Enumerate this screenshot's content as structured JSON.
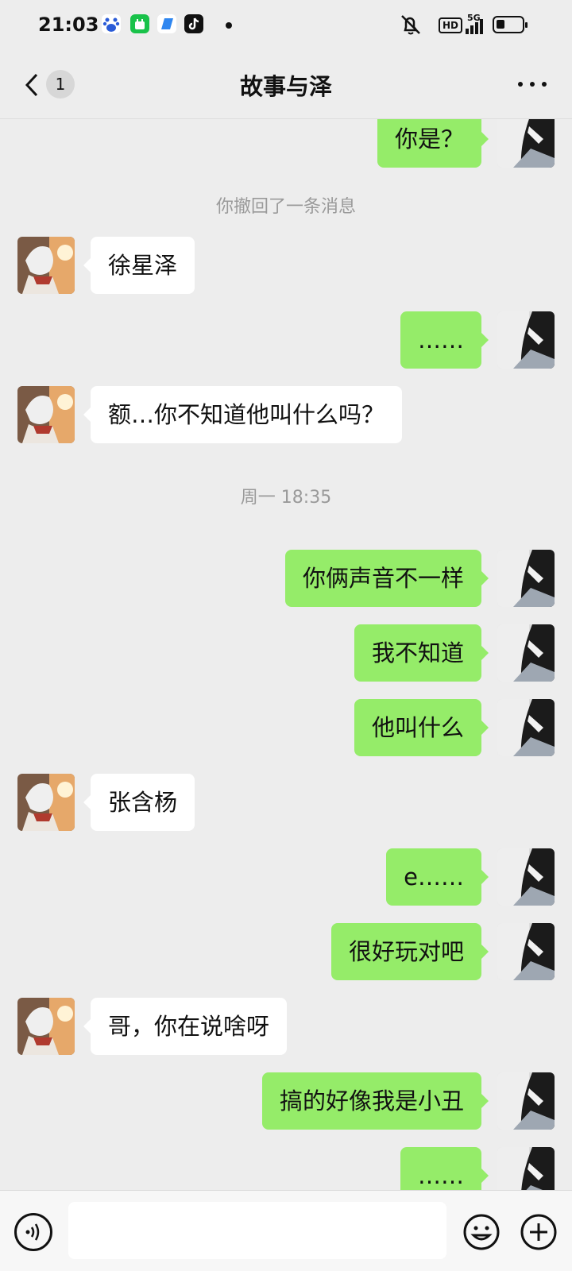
{
  "status_bar": {
    "time": "21:03",
    "icons": [
      "baidu-icon",
      "app-store-icon",
      "blue-app-icon",
      "tiktok-icon",
      "notification-dot",
      "mute-icon",
      "hd-icon",
      "signal-5g-icon",
      "battery-icon"
    ],
    "hd": "HD",
    "network": "5G"
  },
  "header": {
    "unread_count": "1",
    "title": "故事与泽"
  },
  "messages": [
    {
      "side": "out",
      "text": "你是？"
    },
    {
      "type": "system",
      "text": "你撤回了一条消息"
    },
    {
      "side": "in",
      "text": "徐星泽"
    },
    {
      "side": "out",
      "text": "……"
    },
    {
      "side": "in",
      "text": "额…你不知道他叫什么吗？"
    },
    {
      "type": "time",
      "text": "周一 18:35"
    },
    {
      "side": "out",
      "text": "你俩声音不一样"
    },
    {
      "side": "out",
      "text": "我不知道"
    },
    {
      "side": "out",
      "text": "他叫什么"
    },
    {
      "side": "in",
      "text": "张含杨"
    },
    {
      "side": "out",
      "text": "e……"
    },
    {
      "side": "out",
      "text": "很好玩对吧"
    },
    {
      "side": "in",
      "text": "哥，你在说啥呀"
    },
    {
      "side": "out",
      "text": "搞的好像我是小丑"
    },
    {
      "side": "out",
      "text": "……"
    }
  ],
  "input_bar": {
    "value": "",
    "icons": [
      "voice-icon",
      "emoji-icon",
      "plus-icon"
    ]
  },
  "colors": {
    "background": "#ededed",
    "outgoing_bubble": "#95ec69",
    "incoming_bubble": "#ffffff",
    "system_text": "#9a9a9a"
  }
}
